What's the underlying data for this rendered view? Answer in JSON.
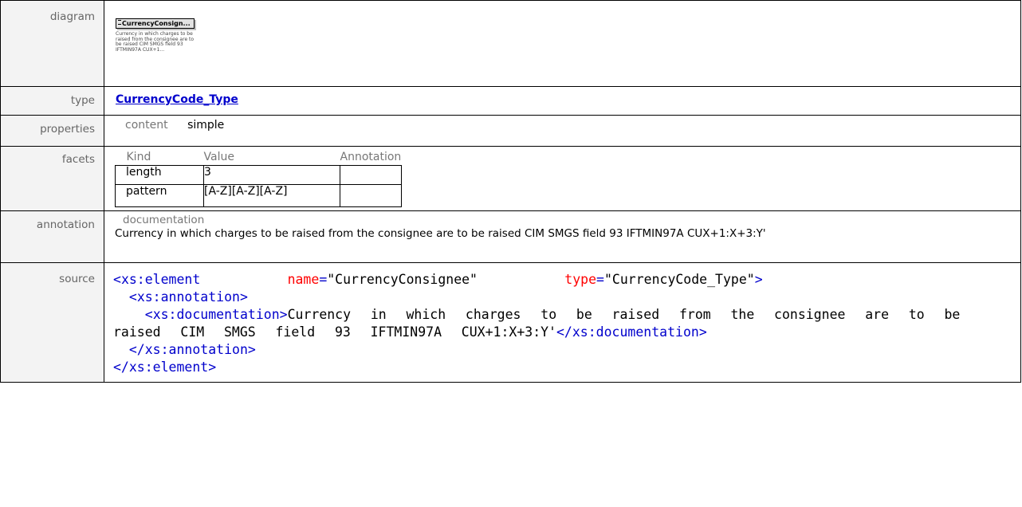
{
  "labels": {
    "diagram": "diagram",
    "type": "type",
    "properties": "properties",
    "facets": "facets",
    "annotation": "annotation",
    "source": "source"
  },
  "diagram": {
    "element_name": "CurrencyConsign...",
    "doc_snippet": "Currency in which charges to be raised from the consignee are to be raised CIM SMGS field 93 IFTMIN97A CUX+1..."
  },
  "type": {
    "link_text": "CurrencyCode_Type"
  },
  "properties": {
    "key": "content",
    "value": "simple"
  },
  "facets": {
    "headers": [
      "Kind",
      "Value",
      "Annotation"
    ],
    "rows": [
      {
        "kind": "length",
        "value": "3",
        "annotation": ""
      },
      {
        "kind": "pattern",
        "value": "[A-Z][A-Z][A-Z]",
        "annotation": ""
      }
    ]
  },
  "annotation": {
    "title": "documentation",
    "text": "Currency in which charges to be raised from the consignee are to be raised CIM SMGS field 93 IFTMIN97A CUX+1:X+3:Y'"
  },
  "source": {
    "open_tag": "xs:element",
    "attr1_name": "name",
    "attr1_value": "\"CurrencyConsignee\"",
    "attr2_name": "type",
    "attr2_value": "\"CurrencyCode_Type\"",
    "annotation_tag": "xs:annotation",
    "documentation_tag": "xs:documentation",
    "doc_text": "Currency in which charges to be raised from the consignee are to be raised CIM SMGS field 93 IFTMIN97A CUX+1:X+3:Y'"
  },
  "colors": {
    "tag": "#0000cc",
    "tagname": "#800000",
    "attr": "#ff0000",
    "label_bg": "#f3f3f3"
  }
}
